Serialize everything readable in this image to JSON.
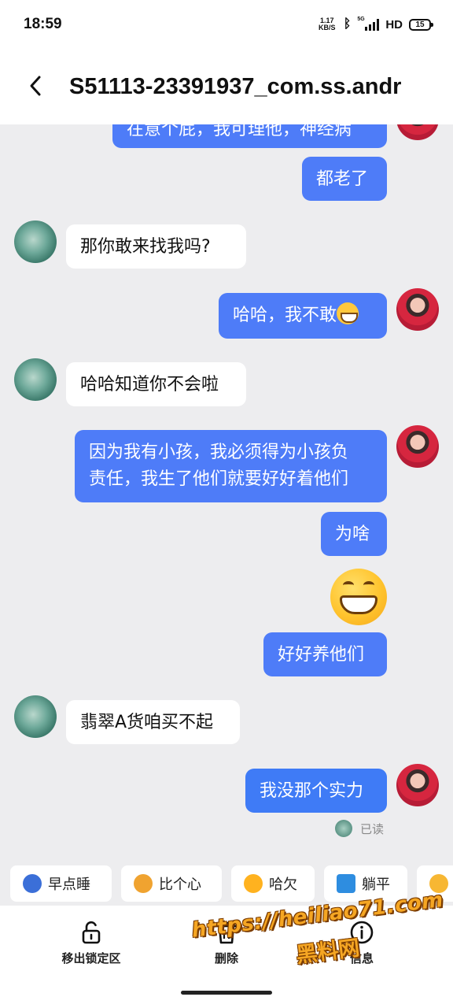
{
  "status_bar": {
    "time": "18:59",
    "net_speed_value": "1.17",
    "net_speed_unit": "KB/S",
    "signal_label": "5G",
    "hd_label": "HD",
    "battery_level": "15"
  },
  "header": {
    "title": "S51113-23391937_com.ss.andr"
  },
  "messages": [
    {
      "side": "out",
      "text": "在意个屁，我可理他，神经病"
    },
    {
      "side": "out",
      "text": "都老了"
    },
    {
      "side": "in",
      "text": "那你敢来找我吗?"
    },
    {
      "side": "out",
      "text": "哈哈，我不敢"
    },
    {
      "side": "in",
      "text": "哈哈知道你不会啦"
    },
    {
      "side": "out",
      "text_line1": "因为我有小孩，我必须得为小孩负",
      "text_line2": "责任，我生了他们就要好好着他们"
    },
    {
      "side": "out",
      "text": "为啥"
    },
    {
      "side": "out",
      "type": "emoji",
      "emoji_name": "grinning-face-emoji"
    },
    {
      "side": "out",
      "text": "好好养他们"
    },
    {
      "side": "in",
      "text": "翡翠A货咱买不起"
    },
    {
      "side": "out",
      "text": "我没那个实力"
    }
  ],
  "read_status": "已读",
  "quick_replies": [
    {
      "label": "早点睡",
      "icon": "moon-sleep-icon",
      "color": "#3b6fd8"
    },
    {
      "label": "比个心",
      "icon": "heart-hands-icon",
      "color": "#f0a330"
    },
    {
      "label": "哈欠",
      "icon": "yawn-face-icon",
      "color": "#ffb21f"
    },
    {
      "label": "躺平",
      "icon": "lie-flat-icon",
      "color": "#2e8de0"
    },
    {
      "label": "",
      "icon": "sticker-icon",
      "color": "#f7b733"
    }
  ],
  "actions": [
    {
      "label": "移出锁定区",
      "icon": "unlock-icon"
    },
    {
      "label": "删除",
      "icon": "trash-icon"
    },
    {
      "label": "信息",
      "icon": "info-icon"
    }
  ],
  "watermark": {
    "url": "https://heiliao71.com",
    "name": "黑料网",
    "color": "#f5a623"
  },
  "colors": {
    "outgoing_bubble": "#4e7cf8",
    "incoming_bubble": "#ffffff",
    "background": "#ededef"
  }
}
